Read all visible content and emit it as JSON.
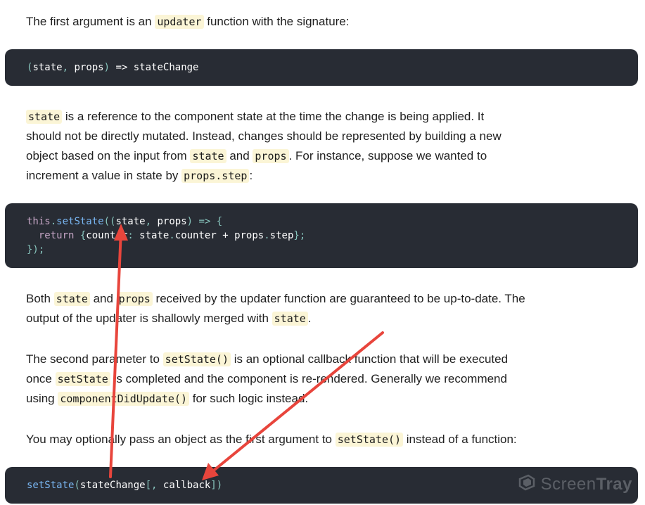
{
  "para1": {
    "prefix": "The first argument is an ",
    "code": "updater",
    "suffix": " function with the signature:"
  },
  "code1": {
    "open_paren": "(",
    "state": "state",
    "comma": ",",
    "props": " props",
    "close_paren": ")",
    "rest": " => stateChange"
  },
  "para2": {
    "code_state": "state",
    "text1": " is a reference to the component state at the time the change is being applied. It should not be directly mutated. Instead, changes should be represented by building a new object based on the input from ",
    "code_state2": "state",
    "text2": " and ",
    "code_props": "props",
    "text3": ". For instance, suppose we wanted to increment a value in state by ",
    "code_props_step": "props.step",
    "text4": ":"
  },
  "code2": {
    "line1_this": "this",
    "line1_dot": ".",
    "line1_fn": "setState",
    "line1_open": "((",
    "line1_state": "state",
    "line1_comma": ",",
    "line1_props": " props",
    "line1_close": ")",
    "line1_arrow": " => {",
    "line2_return": "  return",
    "line2_brace": " {",
    "line2_counter": "counter",
    "line2_colon": ":",
    "line2_expr1": " state",
    "line2_dot1": ".",
    "line2_expr2": "counter",
    "line2_plus": " + props",
    "line2_dot2": ".",
    "line2_expr3": "step",
    "line2_end": "};",
    "line3": "});"
  },
  "para3": {
    "text1": "Both ",
    "code_state": "state",
    "text2": " and ",
    "code_props": "props",
    "text3": " received by the updater function are guaranteed to be up-to-date. The output of the updater is shallowly merged with ",
    "code_state2": "state",
    "text4": "."
  },
  "para4": {
    "text1": "The second parameter to ",
    "code_setstate": "setState()",
    "text2": " is an optional callback function that will be executed once ",
    "code_setstate2": "setState",
    "text3": " is completed and the component is re-rendered. Generally we recommend using ",
    "code_cdu": "componentDidUpdate()",
    "text4": " for such logic instead."
  },
  "para5": {
    "text1": "You may optionally pass an object as the first argument to ",
    "code_setstate": "setState()",
    "text2": " instead of a function:"
  },
  "code3": {
    "fn": "setState",
    "open": "(",
    "arg1": "stateChange",
    "bracket_open": "[",
    "comma": ",",
    "arg2": " callback",
    "bracket_close": "])"
  },
  "watermark": {
    "screen": "Screen",
    "tray": "Tray"
  },
  "colors": {
    "arrow": "#e8453c",
    "code_bg": "#282c34",
    "inline_code_bg": "#fbf5d6"
  }
}
